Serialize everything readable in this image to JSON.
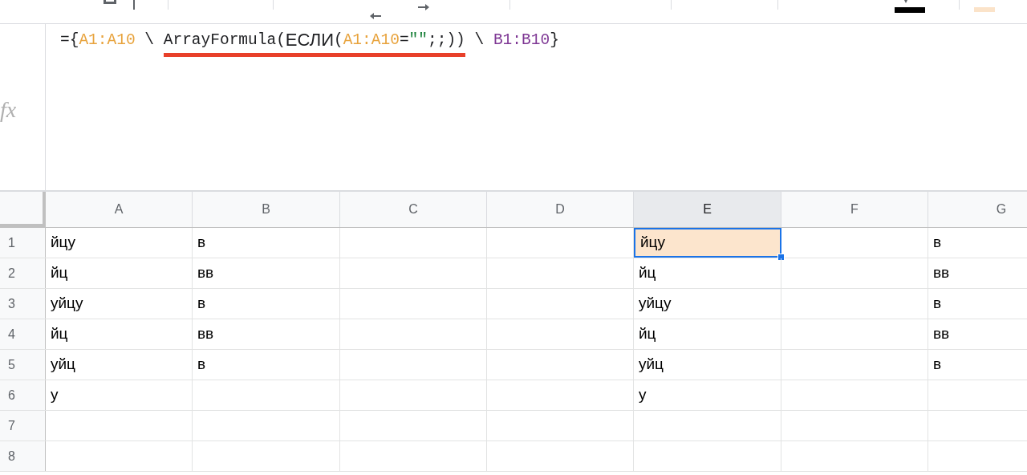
{
  "formula_bar": {
    "label": "fx",
    "segments": [
      {
        "underlined": false,
        "tokens": [
          {
            "kind": "plain",
            "text": "={"
          },
          {
            "kind": "range_a",
            "text": "A1:A10"
          },
          {
            "kind": "plain",
            "text": " \\ "
          }
        ]
      },
      {
        "underlined": true,
        "tokens": [
          {
            "kind": "plain",
            "text": "ArrayFormula("
          },
          {
            "kind": "function",
            "text": "ЕСЛИ"
          },
          {
            "kind": "plain",
            "text": "("
          },
          {
            "kind": "range_a",
            "text": "A1:A10"
          },
          {
            "kind": "plain",
            "text": "="
          },
          {
            "kind": "string",
            "text": "\"\""
          },
          {
            "kind": "plain",
            "text": ";;))"
          }
        ]
      },
      {
        "underlined": false,
        "tokens": [
          {
            "kind": "plain",
            "text": " \\ "
          },
          {
            "kind": "range_b",
            "text": "B1:B10"
          },
          {
            "kind": "plain",
            "text": "}"
          }
        ]
      }
    ]
  },
  "columns": [
    {
      "label": "A",
      "selected": false
    },
    {
      "label": "B",
      "selected": false
    },
    {
      "label": "C",
      "selected": false
    },
    {
      "label": "D",
      "selected": false
    },
    {
      "label": "E",
      "selected": true
    },
    {
      "label": "F",
      "selected": false
    },
    {
      "label": "G",
      "selected": false
    }
  ],
  "rows": [
    {
      "label": "1",
      "cells": [
        {
          "text": "йцу",
          "selected": false
        },
        {
          "text": "в",
          "selected": false
        },
        {
          "selected": false
        },
        {
          "selected": false
        },
        {
          "text": "йцу",
          "selected": true
        },
        {
          "selected": false
        },
        {
          "text": "в",
          "selected": false
        }
      ]
    },
    {
      "label": "2",
      "cells": [
        {
          "text": "йц",
          "selected": false
        },
        {
          "text": "вв",
          "selected": false
        },
        {
          "selected": false
        },
        {
          "selected": false
        },
        {
          "text": "йц",
          "selected": false
        },
        {
          "selected": false
        },
        {
          "text": "вв",
          "selected": false
        }
      ]
    },
    {
      "label": "3",
      "cells": [
        {
          "text": "уйцу",
          "selected": false
        },
        {
          "text": "в",
          "selected": false
        },
        {
          "selected": false
        },
        {
          "selected": false
        },
        {
          "text": "уйцу",
          "selected": false
        },
        {
          "selected": false
        },
        {
          "text": "в",
          "selected": false
        }
      ]
    },
    {
      "label": "4",
      "cells": [
        {
          "text": "йц",
          "selected": false
        },
        {
          "text": "вв",
          "selected": false
        },
        {
          "selected": false
        },
        {
          "selected": false
        },
        {
          "text": "йц",
          "selected": false
        },
        {
          "selected": false
        },
        {
          "text": "вв",
          "selected": false
        }
      ]
    },
    {
      "label": "5",
      "cells": [
        {
          "text": "уйц",
          "selected": false
        },
        {
          "text": "в",
          "selected": false
        },
        {
          "selected": false
        },
        {
          "selected": false
        },
        {
          "text": "уйц",
          "selected": false
        },
        {
          "selected": false
        },
        {
          "text": "в",
          "selected": false
        }
      ]
    },
    {
      "label": "6",
      "cells": [
        {
          "text": "у",
          "selected": false
        },
        {
          "selected": false
        },
        {
          "selected": false
        },
        {
          "selected": false
        },
        {
          "text": "у",
          "selected": false
        },
        {
          "selected": false
        },
        {
          "selected": false
        }
      ]
    },
    {
      "label": "7",
      "cells": [
        {
          "selected": false
        },
        {
          "selected": false
        },
        {
          "selected": false
        },
        {
          "selected": false
        },
        {
          "selected": false
        },
        {
          "selected": false
        },
        {
          "selected": false
        }
      ]
    },
    {
      "label": "8",
      "cells": [
        {
          "selected": false
        },
        {
          "selected": false
        },
        {
          "selected": false
        },
        {
          "selected": false
        },
        {
          "selected": false
        },
        {
          "selected": false
        },
        {
          "selected": false
        }
      ]
    }
  ]
}
